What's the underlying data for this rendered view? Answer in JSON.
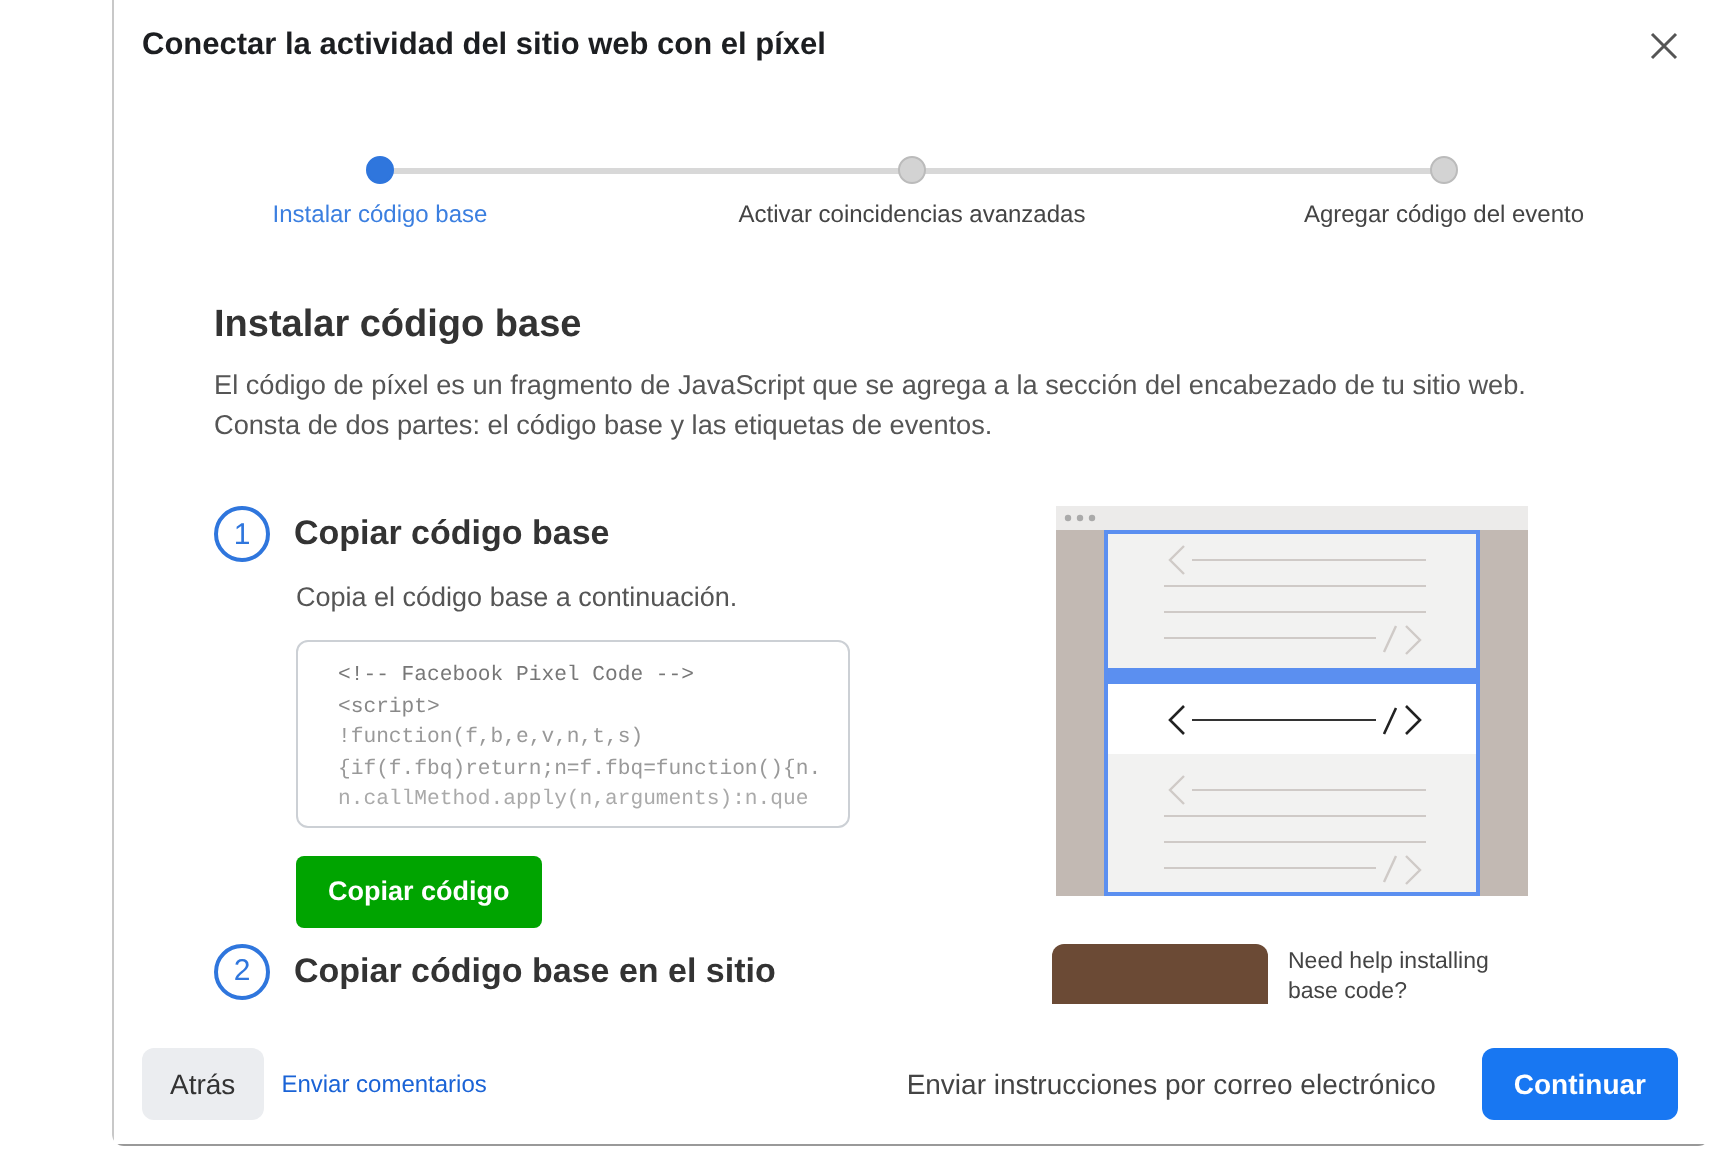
{
  "dialog": {
    "title": "Conectar la actividad del sitio web con el píxel"
  },
  "steps": [
    {
      "label": "Instalar código base",
      "selected": true
    },
    {
      "label": "Activar coincidencias avanzadas",
      "selected": false
    },
    {
      "label": "Agregar código del evento",
      "selected": false
    }
  ],
  "section": {
    "heading": "Instalar código base",
    "description": "El código de píxel es un fragmento de JavaScript que se agrega a la sección del encabezado de tu sitio web. Consta de dos partes: el código base y las etiquetas de eventos."
  },
  "instructions": [
    {
      "number": "1",
      "title": "Copiar código base",
      "text": "Copia el código base a continuación.",
      "code": [
        "<!-- Facebook Pixel Code -->",
        "<script>",
        "!function(f,b,e,v,n,t,s)",
        "{if(f.fbq)return;n=f.fbq=function(){n.",
        "n.callMethod.apply(n,arguments):n.que"
      ],
      "button": "Copiar código"
    },
    {
      "number": "2",
      "title": "Copiar código base en el sitio"
    }
  ],
  "help_video": {
    "text": "Need help installing base code?"
  },
  "footer": {
    "back": "Atrás",
    "feedback_link": "Enviar comentarios",
    "email_link": "Enviar instrucciones por correo electrónico",
    "continue": "Continuar"
  }
}
